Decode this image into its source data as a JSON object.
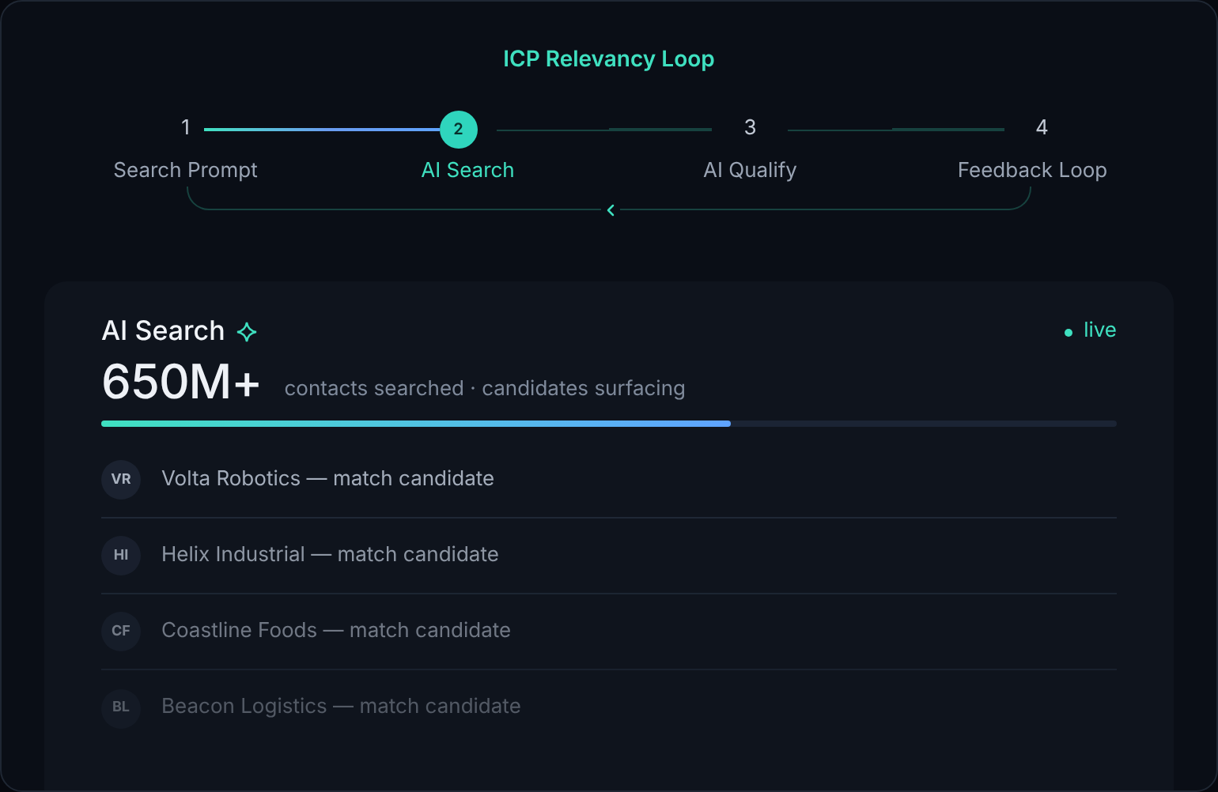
{
  "title": "ICP Relevancy Loop",
  "steps": [
    {
      "number": "1",
      "label": "Search Prompt",
      "selected": false
    },
    {
      "number": "2",
      "label": "AI Search",
      "selected": true
    },
    {
      "number": "3",
      "label": "AI Qualify",
      "selected": false
    },
    {
      "number": "4",
      "label": "Feedback Loop",
      "selected": false
    }
  ],
  "panel": {
    "title": "AI Search",
    "status": "live",
    "metric": "650M+",
    "caption": "contacts searched · candidates surfacing",
    "level": 0.62,
    "rows": [
      {
        "initials": "VR",
        "text": "Volta Robotics — match candidate"
      },
      {
        "initials": "HI",
        "text": "Helix Industrial — match candidate"
      },
      {
        "initials": "CF",
        "text": "Coastline Foods — match candidate"
      },
      {
        "initials": "BL",
        "text": "Beacon Logistics — match candidate"
      }
    ]
  }
}
